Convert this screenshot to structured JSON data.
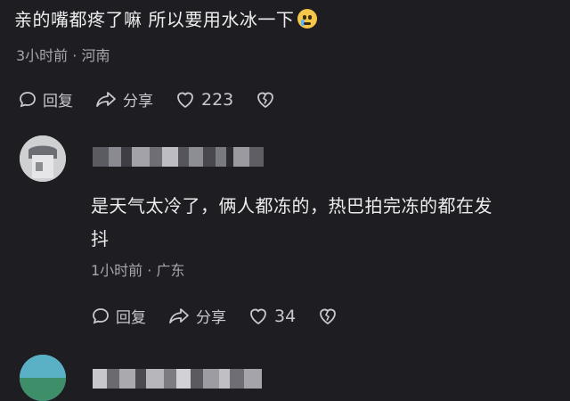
{
  "top_comment": {
    "text": "亲的嘴都疼了嘛  所以要用水冰一下",
    "emoji_icon": "crying-face-icon",
    "meta": "3小时前 · 河南",
    "reply_label": "回复",
    "share_label": "分享",
    "like_count": "223"
  },
  "reply_comment": {
    "text_line1": "是天气太冷了，俩人都冻的，热巴拍完冻的都在发",
    "text_line2": "抖",
    "meta": "1小时前 · 广东",
    "reply_label": "回复",
    "share_label": "分享",
    "like_count": "34"
  },
  "colors": {
    "background": "#1e1e22",
    "text": "#ececed",
    "meta": "#a6a6ab"
  }
}
